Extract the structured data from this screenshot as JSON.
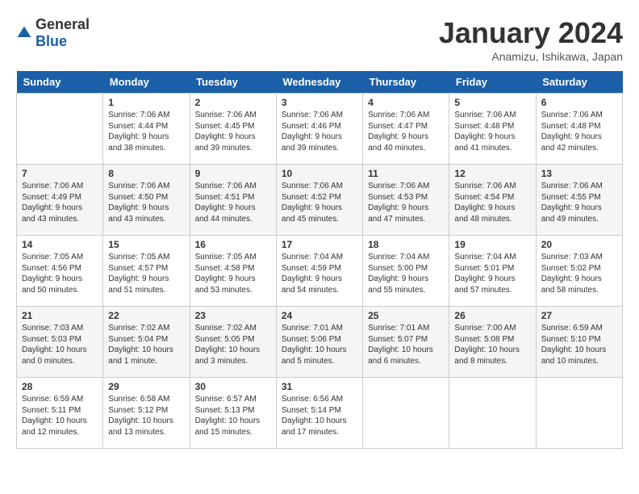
{
  "header": {
    "logo_general": "General",
    "logo_blue": "Blue",
    "title": "January 2024",
    "subtitle": "Anamizu, Ishikawa, Japan"
  },
  "weekdays": [
    "Sunday",
    "Monday",
    "Tuesday",
    "Wednesday",
    "Thursday",
    "Friday",
    "Saturday"
  ],
  "weeks": [
    [
      {
        "day": "",
        "sunrise": "",
        "sunset": "",
        "daylight": ""
      },
      {
        "day": "1",
        "sunrise": "7:06 AM",
        "sunset": "4:44 PM",
        "daylight": "9 hours and 38 minutes."
      },
      {
        "day": "2",
        "sunrise": "7:06 AM",
        "sunset": "4:45 PM",
        "daylight": "9 hours and 39 minutes."
      },
      {
        "day": "3",
        "sunrise": "7:06 AM",
        "sunset": "4:46 PM",
        "daylight": "9 hours and 39 minutes."
      },
      {
        "day": "4",
        "sunrise": "7:06 AM",
        "sunset": "4:47 PM",
        "daylight": "9 hours and 40 minutes."
      },
      {
        "day": "5",
        "sunrise": "7:06 AM",
        "sunset": "4:48 PM",
        "daylight": "9 hours and 41 minutes."
      },
      {
        "day": "6",
        "sunrise": "7:06 AM",
        "sunset": "4:48 PM",
        "daylight": "9 hours and 42 minutes."
      }
    ],
    [
      {
        "day": "7",
        "sunrise": "7:06 AM",
        "sunset": "4:49 PM",
        "daylight": "9 hours and 43 minutes."
      },
      {
        "day": "8",
        "sunrise": "7:06 AM",
        "sunset": "4:50 PM",
        "daylight": "9 hours and 43 minutes."
      },
      {
        "day": "9",
        "sunrise": "7:06 AM",
        "sunset": "4:51 PM",
        "daylight": "9 hours and 44 minutes."
      },
      {
        "day": "10",
        "sunrise": "7:06 AM",
        "sunset": "4:52 PM",
        "daylight": "9 hours and 45 minutes."
      },
      {
        "day": "11",
        "sunrise": "7:06 AM",
        "sunset": "4:53 PM",
        "daylight": "9 hours and 47 minutes."
      },
      {
        "day": "12",
        "sunrise": "7:06 AM",
        "sunset": "4:54 PM",
        "daylight": "9 hours and 48 minutes."
      },
      {
        "day": "13",
        "sunrise": "7:06 AM",
        "sunset": "4:55 PM",
        "daylight": "9 hours and 49 minutes."
      }
    ],
    [
      {
        "day": "14",
        "sunrise": "7:05 AM",
        "sunset": "4:56 PM",
        "daylight": "9 hours and 50 minutes."
      },
      {
        "day": "15",
        "sunrise": "7:05 AM",
        "sunset": "4:57 PM",
        "daylight": "9 hours and 51 minutes."
      },
      {
        "day": "16",
        "sunrise": "7:05 AM",
        "sunset": "4:58 PM",
        "daylight": "9 hours and 53 minutes."
      },
      {
        "day": "17",
        "sunrise": "7:04 AM",
        "sunset": "4:59 PM",
        "daylight": "9 hours and 54 minutes."
      },
      {
        "day": "18",
        "sunrise": "7:04 AM",
        "sunset": "5:00 PM",
        "daylight": "9 hours and 55 minutes."
      },
      {
        "day": "19",
        "sunrise": "7:04 AM",
        "sunset": "5:01 PM",
        "daylight": "9 hours and 57 minutes."
      },
      {
        "day": "20",
        "sunrise": "7:03 AM",
        "sunset": "5:02 PM",
        "daylight": "9 hours and 58 minutes."
      }
    ],
    [
      {
        "day": "21",
        "sunrise": "7:03 AM",
        "sunset": "5:03 PM",
        "daylight": "10 hours and 0 minutes."
      },
      {
        "day": "22",
        "sunrise": "7:02 AM",
        "sunset": "5:04 PM",
        "daylight": "10 hours and 1 minute."
      },
      {
        "day": "23",
        "sunrise": "7:02 AM",
        "sunset": "5:05 PM",
        "daylight": "10 hours and 3 minutes."
      },
      {
        "day": "24",
        "sunrise": "7:01 AM",
        "sunset": "5:06 PM",
        "daylight": "10 hours and 5 minutes."
      },
      {
        "day": "25",
        "sunrise": "7:01 AM",
        "sunset": "5:07 PM",
        "daylight": "10 hours and 6 minutes."
      },
      {
        "day": "26",
        "sunrise": "7:00 AM",
        "sunset": "5:08 PM",
        "daylight": "10 hours and 8 minutes."
      },
      {
        "day": "27",
        "sunrise": "6:59 AM",
        "sunset": "5:10 PM",
        "daylight": "10 hours and 10 minutes."
      }
    ],
    [
      {
        "day": "28",
        "sunrise": "6:59 AM",
        "sunset": "5:11 PM",
        "daylight": "10 hours and 12 minutes."
      },
      {
        "day": "29",
        "sunrise": "6:58 AM",
        "sunset": "5:12 PM",
        "daylight": "10 hours and 13 minutes."
      },
      {
        "day": "30",
        "sunrise": "6:57 AM",
        "sunset": "5:13 PM",
        "daylight": "10 hours and 15 minutes."
      },
      {
        "day": "31",
        "sunrise": "6:56 AM",
        "sunset": "5:14 PM",
        "daylight": "10 hours and 17 minutes."
      },
      {
        "day": "",
        "sunrise": "",
        "sunset": "",
        "daylight": ""
      },
      {
        "day": "",
        "sunrise": "",
        "sunset": "",
        "daylight": ""
      },
      {
        "day": "",
        "sunrise": "",
        "sunset": "",
        "daylight": ""
      }
    ]
  ]
}
